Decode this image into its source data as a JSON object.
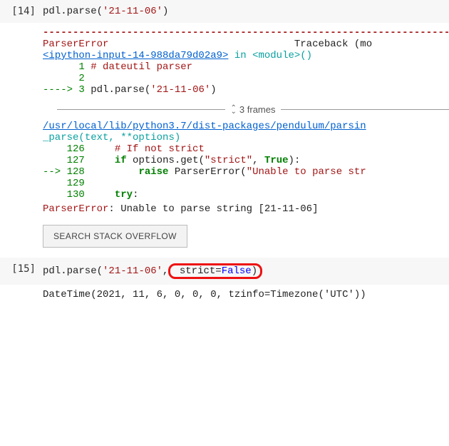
{
  "cells": [
    {
      "prompt_num": 14,
      "code": {
        "fn": "pdl.parse",
        "str_arg": "'21-11-06'"
      }
    },
    {
      "prompt_num": 15,
      "code": {
        "fn": "pdl.parse",
        "str_arg": "'21-11-06'",
        "kw_name": "strict",
        "kw_val": "False"
      }
    }
  ],
  "traceback": {
    "dashes": "---------------------------------------------------------------------------",
    "error_name": "ParserError",
    "traceback_label": "Traceback (mo",
    "ipython_link": "<ipython-input-14-988da79d02a9>",
    "in_text": " in ",
    "module_text": "<module>",
    "call_suffix": "()",
    "src_lines": [
      {
        "prefix": "      ",
        "lineno": "1",
        "content_comment": "# dateutil parser"
      },
      {
        "prefix": "      ",
        "lineno": "2",
        "content_plain": ""
      },
      {
        "prefix_arrow": "----> ",
        "lineno": "3",
        "content_call_fn": "pdl",
        "content_call_method": "parse",
        "content_call_arg": "'21-11-06'"
      }
    ],
    "frames_label": "3 frames",
    "file_link": "/usr/local/lib/python3.7/dist-packages/pendulum/parsin",
    "func_name": "_parse",
    "func_sig": "(text, **options)",
    "body_lines": [
      {
        "lineno": "126",
        "indent": "    ",
        "comment": "# If not strict"
      },
      {
        "lineno": "127",
        "indent": "    ",
        "code_parts": {
          "kw1": "if",
          "mid": " options",
          "dot": ".",
          "attr": "get",
          "paren": "(",
          "str": "\"strict\"",
          "comma": ", ",
          "bool": "True",
          "close": "):"
        }
      },
      {
        "arrow": "--> ",
        "lineno": "128",
        "indent": "        ",
        "code_parts": {
          "kw1": "raise",
          "mid": " ParserError(",
          "str": "\"Unable to parse str"
        }
      },
      {
        "lineno": "129",
        "indent": "",
        "content_plain": ""
      },
      {
        "lineno": "130",
        "indent": "    ",
        "code_parts": {
          "kw1": "try",
          "close": ":"
        }
      }
    ],
    "final_error_name": "ParserError",
    "final_error_msg": ": Unable to parse string [21-11-06]"
  },
  "so_button": "SEARCH STACK OVERFLOW",
  "output_15": "DateTime(2021, 11, 6, 0, 0, 0, tzinfo=Timezone('UTC'))"
}
